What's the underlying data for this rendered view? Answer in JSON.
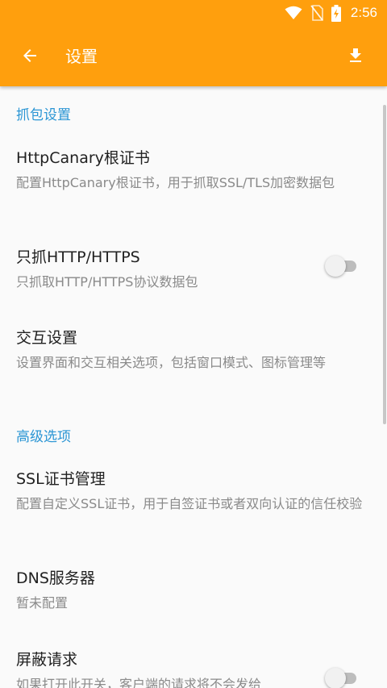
{
  "status_bar": {
    "time": "2:56",
    "icons": [
      "wifi-icon",
      "no-sim-icon",
      "battery-charging-icon"
    ]
  },
  "toolbar": {
    "title": "设置",
    "back_icon": "arrow-back-icon",
    "action_icon": "download-icon"
  },
  "colors": {
    "accent": "#ff9f0d",
    "section_header": "#2a95d4",
    "title_text": "#212121",
    "summary_text": "#8a8a8a"
  },
  "sections": [
    {
      "header": "抓包设置",
      "items": [
        {
          "title": "HttpCanary根证书",
          "summary": "配置HttpCanary根证书，用于抓取SSL/TLS加密数据包"
        },
        {
          "title": "只抓HTTP/HTTPS",
          "summary": "只抓取HTTP/HTTPS协议数据包",
          "switch_on": false
        },
        {
          "title": "交互设置",
          "summary": "设置界面和交互相关选项，包括窗口模式、图标管理等"
        }
      ]
    },
    {
      "header": "高级选项",
      "items": [
        {
          "title": "SSL证书管理",
          "summary": "配置自定义SSL证书，用于自签证书或者双向认证的信任校验"
        },
        {
          "title": "DNS服务器",
          "summary": "暂未配置"
        },
        {
          "title": "屏蔽请求",
          "summary": "如果打开此开关，客户端的请求将不会发给",
          "switch_on": false
        }
      ]
    }
  ]
}
